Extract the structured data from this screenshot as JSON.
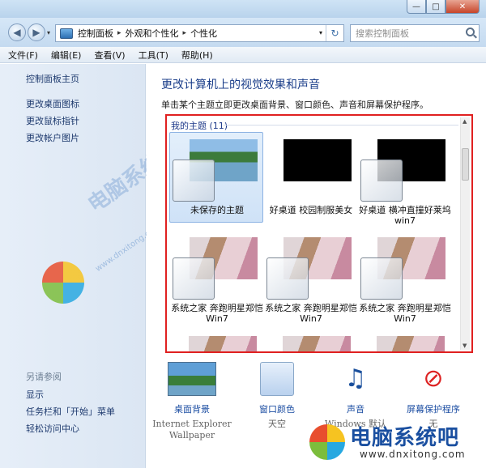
{
  "window": {
    "min_label": "—",
    "max_label": "□",
    "close_label": "✕"
  },
  "nav": {
    "back_icon": "back-arrow-icon",
    "forward_icon": "forward-arrow-icon",
    "back_glyph": "◀",
    "forward_glyph": "▶",
    "history_glyph": "▾"
  },
  "address": {
    "breadcrumbs": [
      "控制面板",
      "外观和个性化",
      "个性化"
    ],
    "sep": "▸",
    "drop": "▾",
    "refresh_glyph": "↻"
  },
  "search": {
    "placeholder": "搜索控制面板"
  },
  "menubar": [
    "文件(F)",
    "编辑(E)",
    "查看(V)",
    "工具(T)",
    "帮助(H)"
  ],
  "sidebar": {
    "home": "控制面板主页",
    "links": [
      "更改桌面图标",
      "更改鼠标指针",
      "更改帐户图片"
    ],
    "see_also_title": "另请参阅",
    "see_also": [
      "显示",
      "任务栏和「开始」菜单",
      "轻松访问中心"
    ],
    "watermark": "电脑系统吧",
    "watermark_url": "www.dnxitong.com"
  },
  "main": {
    "title": "更改计算机上的视觉效果和声音",
    "description": "单击某个主题立即更改桌面背景、窗口颜色、声音和屏幕保护程序。",
    "group_title": "我的主题 (11)",
    "themes": [
      {
        "label": "未保存的主题",
        "style": "lake",
        "selected": true,
        "glass": true
      },
      {
        "label": "好桌道 校园制服美女",
        "style": "black",
        "selected": false,
        "glass": false
      },
      {
        "label": "好桌道 横冲直撞好莱坞win7",
        "style": "black",
        "selected": false,
        "glass": true
      },
      {
        "label": "系统之家 奔跑明星郑恺Win7",
        "style": "portrait",
        "selected": false,
        "glass": true
      },
      {
        "label": "系统之家 奔跑明星郑恺Win7",
        "style": "portrait",
        "selected": false,
        "glass": true
      },
      {
        "label": "系统之家 奔跑明星郑恺Win7",
        "style": "portrait",
        "selected": false,
        "glass": true
      }
    ],
    "scroll_up": "▲",
    "scroll_down": "▼"
  },
  "bottom": [
    {
      "link": "桌面背景",
      "sub": "Internet Explorer Wallpaper",
      "icon": "desktop-background-icon"
    },
    {
      "link": "窗口颜色",
      "sub": "天空",
      "icon": "window-color-icon"
    },
    {
      "link": "声音",
      "sub": "Windows 默认",
      "icon": "sound-icon",
      "glyph": "♫"
    },
    {
      "link": "屏幕保护程序",
      "sub": "无",
      "icon": "screensaver-icon",
      "glyph": "⊘"
    }
  ],
  "brand": {
    "name": "电脑系统吧",
    "url": "www.dnxitong.com"
  },
  "colors": {
    "accent": "#1b3e8a",
    "highlight_border": "#e02020",
    "selected_bg": "#cfe2f7"
  }
}
